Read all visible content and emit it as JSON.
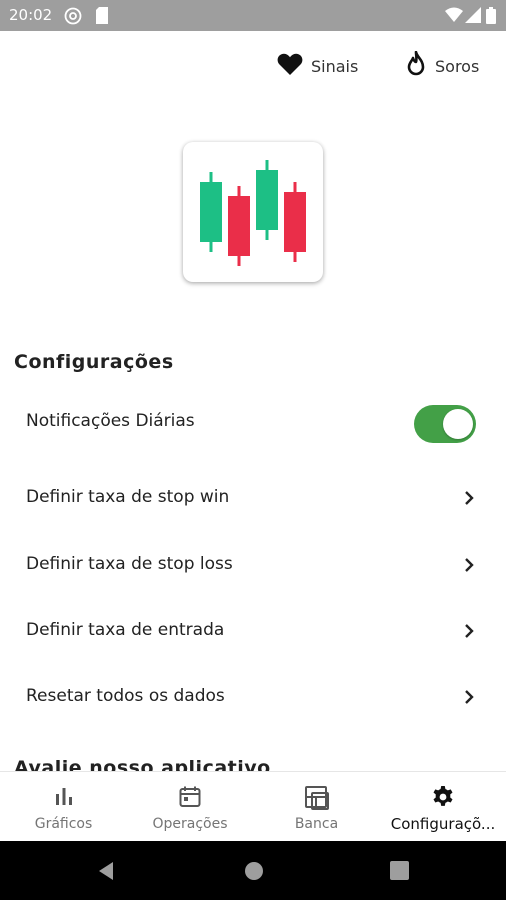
{
  "status_bar": {
    "time": "20:02",
    "left_icons": [
      "at-sign-icon",
      "sd-card-icon"
    ],
    "right_icons": [
      "wifi-icon",
      "signal-icon",
      "battery-icon"
    ]
  },
  "header": {
    "actions": [
      {
        "label": "Sinais",
        "icon": "heart-icon"
      },
      {
        "label": "Soros",
        "icon": "fire-icon"
      }
    ]
  },
  "logo": {
    "icon": "candlestick-chart-logo",
    "colors": {
      "bull": "#1dbf85",
      "bear": "#ea2e49"
    }
  },
  "settings": {
    "title": "Configurações",
    "items": [
      {
        "label": "Notificações Diárias",
        "control": "toggle",
        "checked": true
      },
      {
        "label": "Definir taxa de stop win",
        "control": "chevron"
      },
      {
        "label": "Definir taxa de stop loss",
        "control": "chevron"
      },
      {
        "label": "Definir taxa de entrada",
        "control": "chevron"
      },
      {
        "label": "Resetar todos os dados",
        "control": "chevron"
      }
    ]
  },
  "next_section": {
    "title": "Avalie nosso aplicativo"
  },
  "bottom_nav": {
    "tabs": [
      {
        "label": "Gráficos",
        "icon": "bar-chart-icon",
        "active": false
      },
      {
        "label": "Operações",
        "icon": "calendar-icon",
        "active": false
      },
      {
        "label": "Banca",
        "icon": "dashboard-icon",
        "active": false
      },
      {
        "label": "Configuraçõ...",
        "icon": "gear-icon",
        "active": true
      }
    ]
  },
  "system_nav": {
    "buttons": [
      "back-icon",
      "home-icon",
      "recents-icon"
    ]
  },
  "colors": {
    "toggle_on": "#43a047",
    "nav_bar": "#000000",
    "status_bar": "#9e9e9e"
  }
}
